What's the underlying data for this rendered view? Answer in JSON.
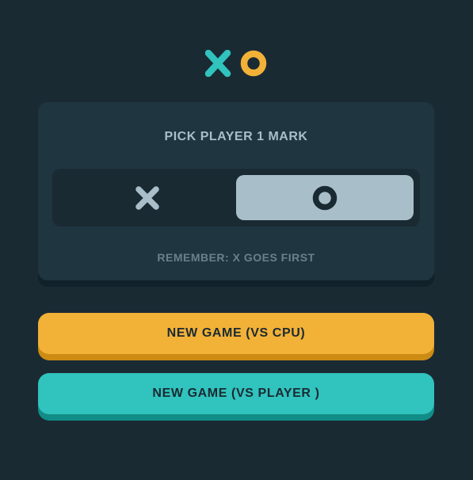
{
  "logo": {
    "icons": [
      "x-mark-icon",
      "o-mark-icon"
    ],
    "colors": {
      "x": "#31C3BD",
      "o": "#F2B137"
    }
  },
  "mark_picker": {
    "title": "PICK PLAYER 1 MARK",
    "options": [
      {
        "icon": "x-mark-icon",
        "selected": false
      },
      {
        "icon": "o-mark-icon",
        "selected": true
      }
    ],
    "note": "REMEMBER: X GOES FIRST"
  },
  "buttons": {
    "vs_cpu": "NEW GAME (VS CPU)",
    "vs_player": "NEW GAME (VS PLAYER )"
  },
  "colors": {
    "background": "#1A2A33",
    "card": "#1F3641",
    "silver": "#A8BFC9",
    "yellow": "#F2B137",
    "teal": "#31C3BD"
  }
}
